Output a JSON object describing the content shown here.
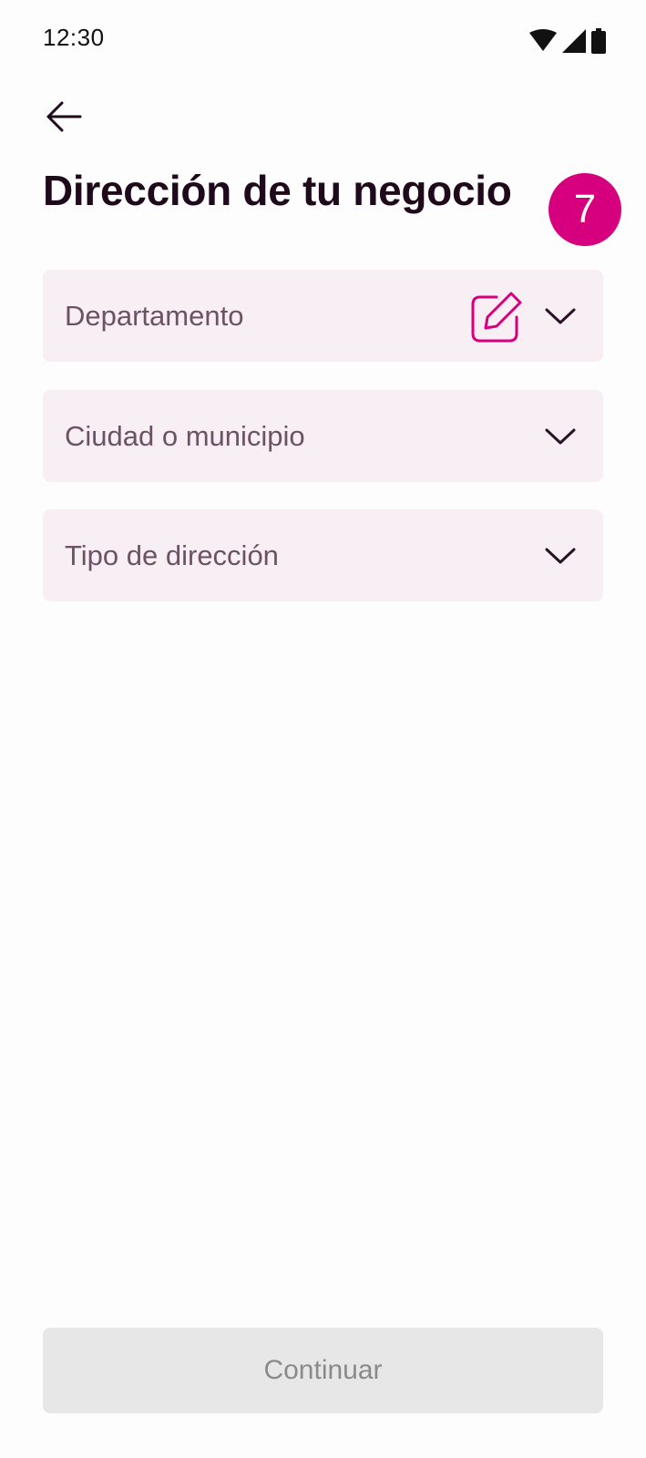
{
  "status_bar": {
    "time": "12:30",
    "icons": [
      "wifi-icon",
      "signal-icon",
      "battery-icon"
    ]
  },
  "header": {
    "back_icon": "arrow-left-icon",
    "title": "Dirección de tu negocio",
    "step_badge": "7"
  },
  "form": {
    "fields": [
      {
        "label": "Departamento",
        "icon": "chevron-down-icon",
        "extra_icon": "edit-icon"
      },
      {
        "label": "Ciudad o municipio",
        "icon": "chevron-down-icon"
      },
      {
        "label": "Tipo de dirección",
        "icon": "chevron-down-icon"
      }
    ]
  },
  "footer": {
    "continue_label": "Continuar"
  },
  "colors": {
    "accent": "#d6007f",
    "field_background": "#f7eff4",
    "disabled_button": "#e7e7e7",
    "title_text": "#1f0a1c"
  }
}
